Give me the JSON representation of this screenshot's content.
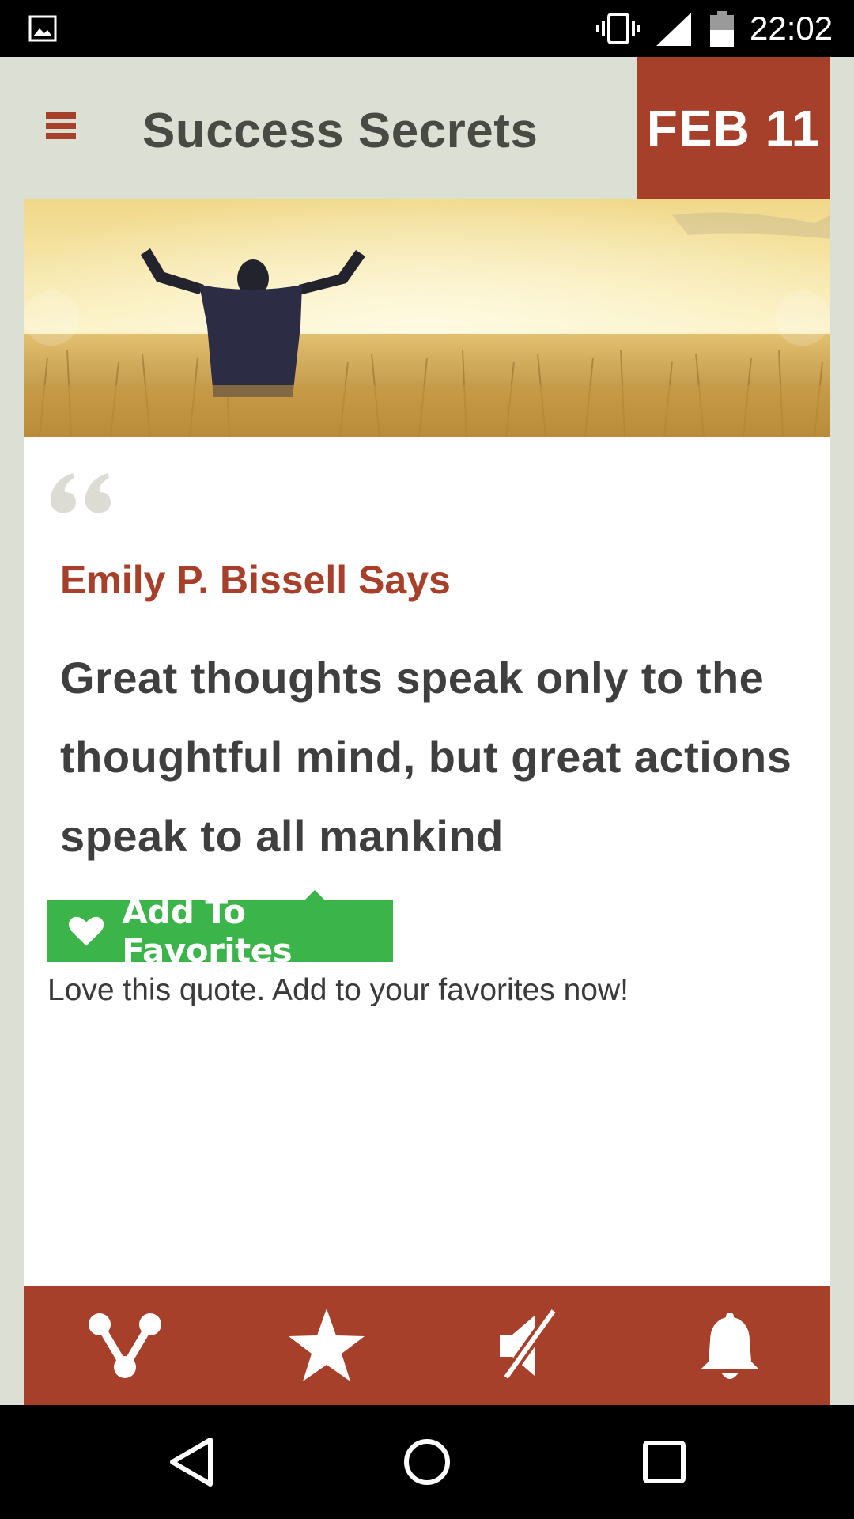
{
  "status_bar": {
    "time": "22:02",
    "icons": [
      "gallery-icon",
      "vibrate-icon",
      "signal-icon",
      "battery-icon"
    ]
  },
  "header": {
    "title": "Success Secrets",
    "date": "FEB 11",
    "menu_icon": "hamburger-menu-icon"
  },
  "hero": {
    "image": "man-with-raised-arms-in-wheat-field",
    "prev_icon": "chevron-left-icon",
    "next_icon": "chevron-right-icon"
  },
  "quote": {
    "author_line": "Emily P. Bissell Says",
    "text": "Great thoughts speak only to the thoughtful mind, but great actions speak to all mankind"
  },
  "favorites": {
    "button_label": "Add To Favorites",
    "hint": "Love this quote. Add to your favorites now!"
  },
  "toolbar": {
    "items": [
      "share-icon",
      "star-icon",
      "mute-icon",
      "bell-icon"
    ]
  },
  "nav_bar": {
    "items": [
      "back-icon",
      "home-icon",
      "recents-icon"
    ]
  },
  "colors": {
    "accent": "#a7402a",
    "favorite_green": "#3bb44a",
    "background": "#dcdfd3"
  }
}
